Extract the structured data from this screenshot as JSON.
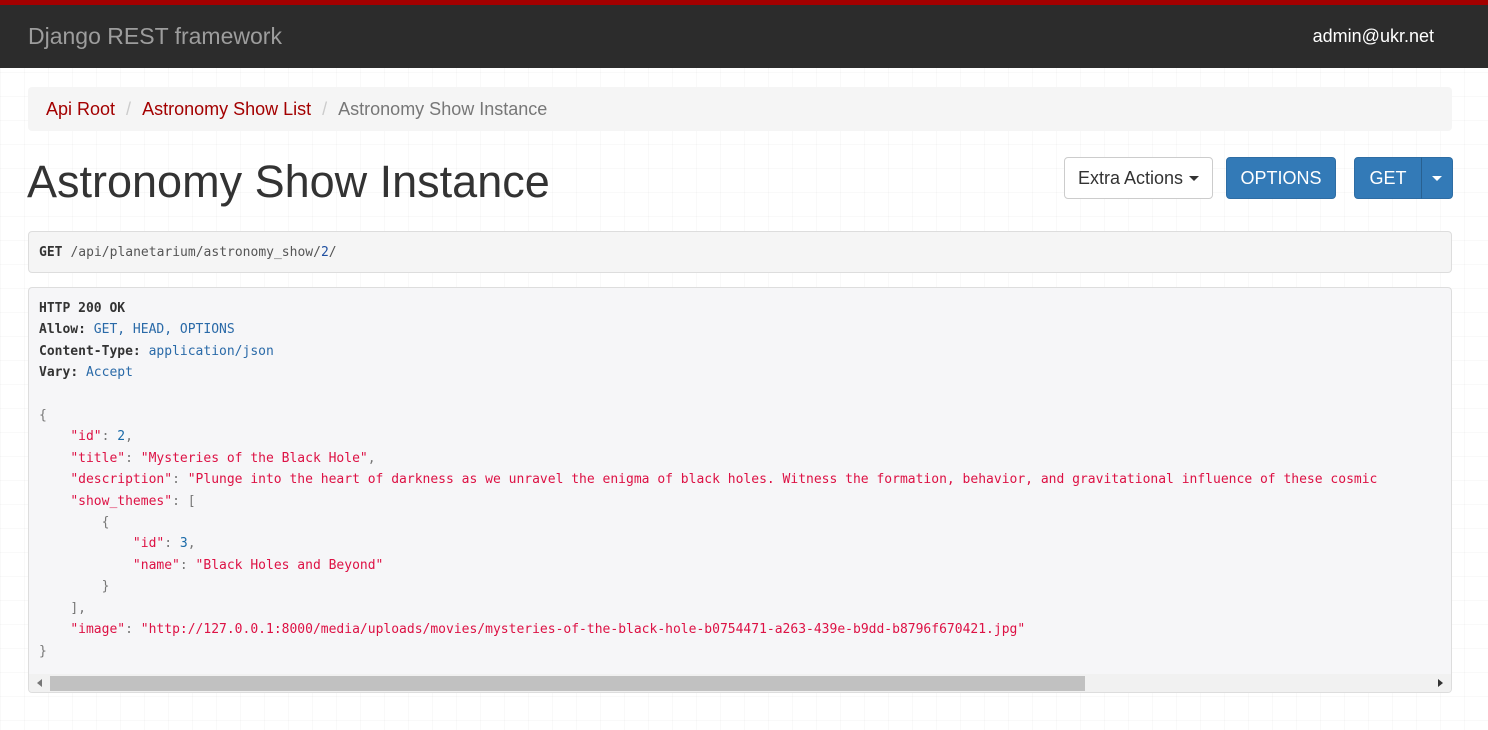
{
  "navbar": {
    "brand": "Django REST framework",
    "user": "admin@ukr.net"
  },
  "breadcrumb": {
    "items": [
      "Api Root",
      "Astronomy Show List"
    ],
    "active": "Astronomy Show Instance"
  },
  "page_title": "Astronomy Show Instance",
  "actions": {
    "extra_actions": "Extra Actions",
    "options": "OPTIONS",
    "get": "GET"
  },
  "request": {
    "method": "GET",
    "path": "/api/planetarium/astronomy_show/",
    "id": "2",
    "trailing": "/"
  },
  "response": {
    "status": "HTTP 200 OK",
    "headers": [
      {
        "key": "Allow",
        "value": "GET, HEAD, OPTIONS"
      },
      {
        "key": "Content-Type",
        "value": "application/json"
      },
      {
        "key": "Vary",
        "value": "Accept"
      }
    ],
    "body": {
      "id": "2",
      "title": "\"Mysteries of the Black Hole\"",
      "description": "\"Plunge into the heart of darkness as we unravel the enigma of black holes. Witness the formation, behavior, and gravitational influence of these cosmic",
      "show_themes": [
        {
          "id": "3",
          "name": "\"Black Holes and Beyond\""
        }
      ],
      "image": "\"http://127.0.0.1:8000/media/uploads/movies/mysteries-of-the-black-hole-b0754471-a263-439e-b9dd-b8796f670421.jpg\""
    }
  },
  "colors": {
    "accent": "#a30000",
    "navbar": "#2c2c2c",
    "primary_button": "#337ab7",
    "json_string": "#dd1144",
    "json_number": "#1a6aa8"
  }
}
